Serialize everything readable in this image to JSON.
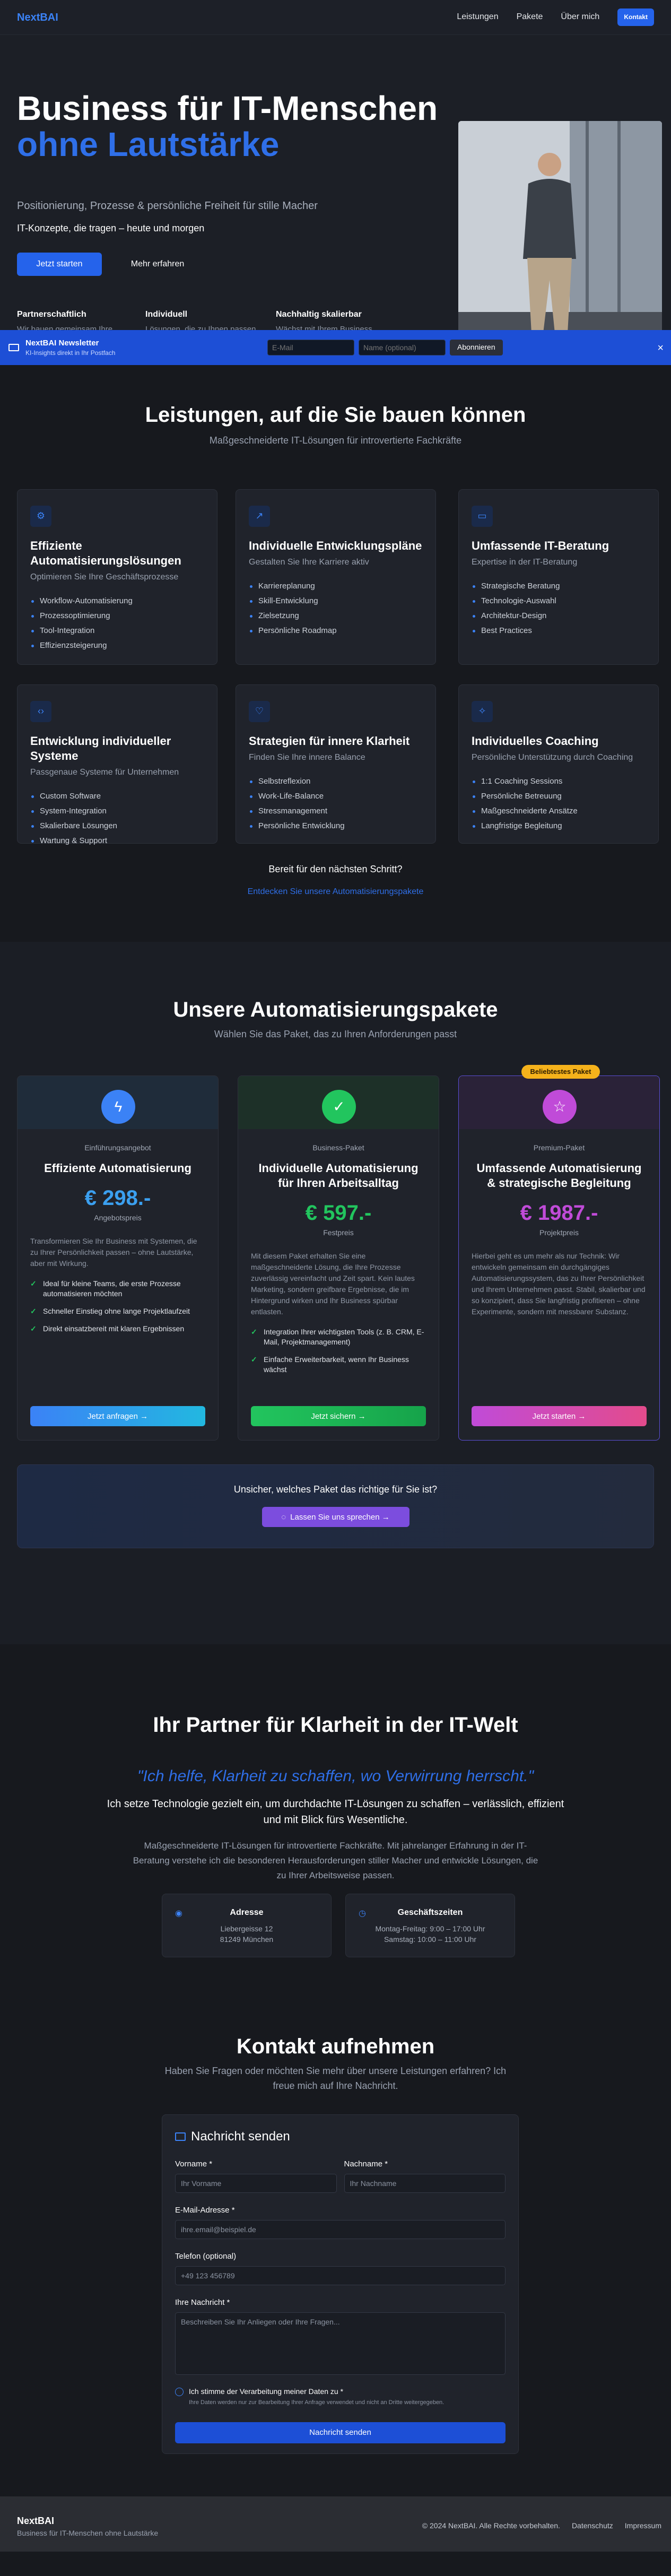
{
  "header": {
    "logo": "NextBAI",
    "nav": [
      "Leistungen",
      "Pakete",
      "Über mich"
    ],
    "cta": "Kontakt"
  },
  "hero": {
    "title_line1": "Business für IT-Menschen",
    "title_line2": "ohne Lautstärke",
    "subtitle": "Positionierung, Prozesse & persönliche Freiheit für stille Macher",
    "tagline": "IT-Konzepte, die tragen – heute und morgen",
    "primary_button": "Jetzt starten",
    "secondary_button": "Mehr erfahren",
    "features": [
      {
        "title": "Partnerschaftlich",
        "text": "Wir bauen gemeinsam Ihre Systeme"
      },
      {
        "title": "Individuell",
        "text": "Lösungen, die zu Ihnen passen"
      },
      {
        "title": "Nachhaltig skalierbar",
        "text": "Wächst mit Ihrem Business"
      }
    ]
  },
  "newsletter": {
    "title": "NextBAI Newsletter",
    "subtitle": "KI-Insights direkt in Ihr Postfach",
    "email_placeholder": "E-Mail",
    "name_placeholder": "Name (optional)",
    "button": "Abonnieren",
    "close": "×"
  },
  "services": {
    "title": "Leistungen, auf die Sie bauen können",
    "subtitle": "Maßgeschneiderte IT-Lösungen für introvertierte Fachkräfte",
    "cards": [
      {
        "icon": "gear-icon",
        "title": "Effiziente Automatisierungslösungen",
        "subtitle": "Optimieren Sie Ihre Geschäftsprozesse",
        "items": [
          "Workflow-Automatisierung",
          "Prozessoptimierung",
          "Tool-Integration",
          "Effizienzsteigerung"
        ]
      },
      {
        "icon": "trend-icon",
        "title": "Individuelle Entwicklungspläne",
        "subtitle": "Gestalten Sie Ihre Karriere aktiv",
        "items": [
          "Karriereplanung",
          "Skill-Entwicklung",
          "Zielsetzung",
          "Persönliche Roadmap"
        ]
      },
      {
        "icon": "chat-icon",
        "title": "Umfassende IT-Beratung",
        "subtitle": "Expertise in der IT-Beratung",
        "items": [
          "Strategische Beratung",
          "Technologie-Auswahl",
          "Architektur-Design",
          "Best Practices"
        ]
      },
      {
        "icon": "code-icon",
        "title": "Entwicklung individueller Systeme",
        "subtitle": "Passgenaue Systeme für Unternehmen",
        "items": [
          "Custom Software",
          "System-Integration",
          "Skalierbare Lösungen",
          "Wartung & Support"
        ]
      },
      {
        "icon": "heart-icon",
        "title": "Strategien für innere Klarheit",
        "subtitle": "Finden Sie Ihre innere Balance",
        "items": [
          "Selbstreflexion",
          "Work-Life-Balance",
          "Stressmanagement",
          "Persönliche Entwicklung"
        ]
      },
      {
        "icon": "coach-icon",
        "title": "Individuelles Coaching",
        "subtitle": "Persönliche Unterstützung durch Coaching",
        "items": [
          "1:1 Coaching Sessions",
          "Persönliche Betreuung",
          "Maßgeschneiderte Ansätze",
          "Langfristige Begleitung"
        ]
      }
    ],
    "next_step": "Bereit für den nächsten Schritt?",
    "next_link": "Entdecken Sie unsere Automatisierungspakete"
  },
  "packages": {
    "title": "Unsere Automatisierungspakete",
    "subtitle": "Wählen Sie das Paket, das zu Ihren Anforderungen passt",
    "popular": "Beliebtestes Paket",
    "items": [
      {
        "label": "Einführungsangebot",
        "title": "Effiziente Automatisierung",
        "price": "€ 298.-",
        "price_label": "Angebotspreis",
        "desc": "Transformieren Sie Ihr Business mit Systemen, die zu Ihrer Persönlichkeit passen – ohne Lautstärke, aber mit Wirkung.",
        "items": [
          "Ideal für kleine Teams, die erste Prozesse automatisieren möchten",
          "Schneller Einstieg ohne lange Projektlaufzeit",
          "Direkt einsatzbereit mit klaren Ergebnissen"
        ],
        "button": "Jetzt anfragen →",
        "color": "#3ba0f0"
      },
      {
        "label": "Business-Paket",
        "title": "Individuelle Automatisierung für Ihren Arbeitsalltag",
        "price": "€ 597.-",
        "price_label": "Festpreis",
        "desc": "Mit diesem Paket erhalten Sie eine maßgeschneiderte Lösung, die Ihre Prozesse zuverlässig vereinfacht und Zeit spart. Kein lautes Marketing, sondern greifbare Ergebnisse, die im Hintergrund wirken und Ihr Business spürbar entlasten.",
        "items": [
          "Integration Ihrer wichtigsten Tools (z. B. CRM, E-Mail, Projektmanagement)",
          "Einfache Erweiterbarkeit, wenn Ihr Business wächst"
        ],
        "button": "Jetzt sichern →",
        "color": "#22c55e"
      },
      {
        "label": "Premium-Paket",
        "title": "Umfassende Automatisierung & strategische Begleitung",
        "price": "€ 1987.-",
        "price_label": "Projektpreis",
        "desc": "Hierbei geht es um mehr als nur Technik: Wir entwickeln gemeinsam ein durchgängiges Automatisierungssystem, das zu Ihrer Persönlichkeit und Ihrem Unternehmen passt. Stabil, skalierbar und so konzipiert, dass Sie langfristig profitieren – ohne Experimente, sondern mit messbarer Substanz.",
        "items": [],
        "button": "Jetzt starten →",
        "color": "#c04bd8"
      }
    ],
    "help_text": "Unsicher, welches Paket das richtige für Sie ist?",
    "help_button": "Lassen Sie uns sprechen →"
  },
  "about": {
    "title": "Ihr Partner für Klarheit in der IT-Welt",
    "quote": "\"Ich helfe, Klarheit zu schaffen, wo Verwirrung herrscht.\"",
    "lead": "Ich setze Technologie gezielt ein, um durchdachte IT-Lösungen zu schaffen – verlässlich, effizient und mit Blick fürs Wesentliche.",
    "text": "Maßgeschneiderte IT-Lösungen für introvertierte Fachkräfte. Mit jahrelanger Erfahrung in der IT-Beratung verstehe ich die besonderen Herausforderungen stiller Macher und entwickle Lösungen, die zu Ihrer Arbeitsweise passen.",
    "address_title": "Adresse",
    "address_line1": "Liebergeisse 12",
    "address_line2": "81249 München",
    "hours_title": "Geschäftszeiten",
    "hours_line1": "Montag-Freitag: 9:00 – 17:00 Uhr",
    "hours_line2": "Samstag: 10:00 – 11:00 Uhr"
  },
  "contact": {
    "title": "Kontakt aufnehmen",
    "subtitle": "Haben Sie Fragen oder möchten Sie mehr über unsere Leistungen erfahren? Ich freue mich auf Ihre Nachricht.",
    "form_title": "Nachricht senden",
    "first_label": "Vorname *",
    "first_ph": "Ihr Vorname",
    "last_label": "Nachname *",
    "last_ph": "Ihr Nachname",
    "email_label": "E-Mail-Adresse *",
    "email_ph": "ihre.email@beispiel.de",
    "phone_label": "Telefon (optional)",
    "phone_ph": "+49 123 456789",
    "msg_label": "Ihre Nachricht *",
    "msg_ph": "Beschreiben Sie Ihr Anliegen oder Ihre Fragen...",
    "consent": "Ich stimme der Verarbeitung meiner Daten zu *",
    "consent_sub": "Ihre Daten werden nur zur Bearbeitung Ihrer Anfrage verwendet und nicht an Dritte weitergegeben.",
    "submit": "Nachricht senden"
  },
  "footer": {
    "brand": "NextBAI",
    "tagline": "Business für IT-Menschen ohne Lautstärke",
    "copyright": "© 2024 NextBAI. Alle Rechte vorbehalten.",
    "links": [
      "Datenschutz",
      "Impressum"
    ]
  }
}
